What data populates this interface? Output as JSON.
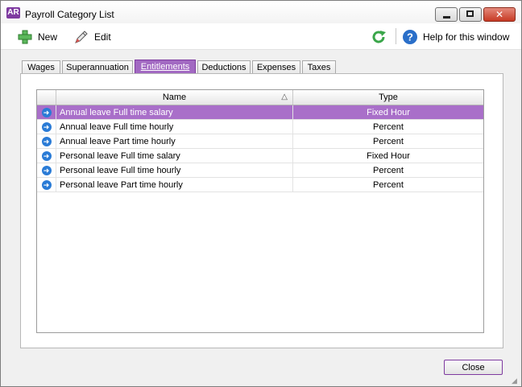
{
  "window": {
    "app_badge": "AR",
    "title": "Payroll Category List"
  },
  "toolbar": {
    "new_label": "New",
    "edit_label": "Edit",
    "help_label": "Help for this window"
  },
  "tabs": [
    {
      "label": "Wages",
      "active": false
    },
    {
      "label": "Superannuation",
      "active": false
    },
    {
      "label": "Entitlements",
      "active": true
    },
    {
      "label": "Deductions",
      "active": false
    },
    {
      "label": "Expenses",
      "active": false
    },
    {
      "label": "Taxes",
      "active": false
    }
  ],
  "grid": {
    "columns": {
      "name": "Name",
      "type": "Type"
    },
    "sort_indicator": "△",
    "rows": [
      {
        "name": "Annual leave Full time salary",
        "type": "Fixed Hour",
        "selected": true
      },
      {
        "name": "Annual leave Full time hourly",
        "type": "Percent",
        "selected": false
      },
      {
        "name": "Annual leave Part time hourly",
        "type": "Percent",
        "selected": false
      },
      {
        "name": "Personal leave Full time salary",
        "type": "Fixed Hour",
        "selected": false
      },
      {
        "name": "Personal leave Full time hourly",
        "type": "Percent",
        "selected": false
      },
      {
        "name": "Personal leave Part time hourly",
        "type": "Percent",
        "selected": false
      }
    ]
  },
  "footer": {
    "close_label": "Close"
  },
  "colors": {
    "accent": "#a96fc9",
    "brand": "#7e3aa0",
    "row_icon": "#2a7bd6"
  },
  "icons": {
    "new": "plus-icon",
    "edit": "pencil-icon",
    "refresh": "refresh-icon",
    "help": "help-icon",
    "row": "arrow-right-icon"
  }
}
